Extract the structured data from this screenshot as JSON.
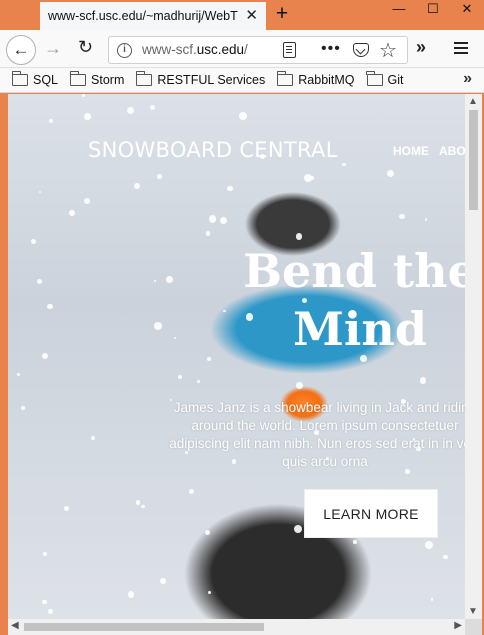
{
  "browser": {
    "tab_title": "www-scf.usc.edu/~madhurij/WebT",
    "tab_close": "✕",
    "new_tab": "+",
    "window_controls": {
      "minimize": "—",
      "maximize": "☐",
      "close": "✕"
    },
    "url_host": "www-scf.usc.edu",
    "url_rest": "/",
    "url_prefix": "www-scf.",
    "url_domain": "usc.edu"
  },
  "bookmarks": [
    {
      "label": "SQL"
    },
    {
      "label": "Storm"
    },
    {
      "label": "RESTFUL Services"
    },
    {
      "label": "RabbitMQ"
    },
    {
      "label": "Git"
    }
  ],
  "site": {
    "brand": "SNOWBOARD CENTRAL",
    "nav": [
      "HOME",
      "ABOU"
    ],
    "headline_line1": "Bend the",
    "headline_line2": "Mind",
    "tagline": "James Janz is a showbear living in Jack and riding around the world. Lorem ipsum consectetuer adipiscing elit nam nibh. Nun eros sed erat in in velit quis arcu orna",
    "cta": "LEARN MORE"
  },
  "icons": {
    "back": "back-arrow-icon",
    "forward": "forward-arrow-icon",
    "reload": "reload-icon",
    "info": "info-icon",
    "reader": "reader-view-icon",
    "more": "more-dots-icon",
    "pocket": "pocket-icon",
    "bookmark": "star-icon",
    "overflow": "chevron-double-right-icon",
    "menu": "hamburger-menu-icon"
  },
  "colors": {
    "titlebar": "#e8834e",
    "cta_bg": "#ffffff",
    "jacket": "#1c8fc4"
  }
}
